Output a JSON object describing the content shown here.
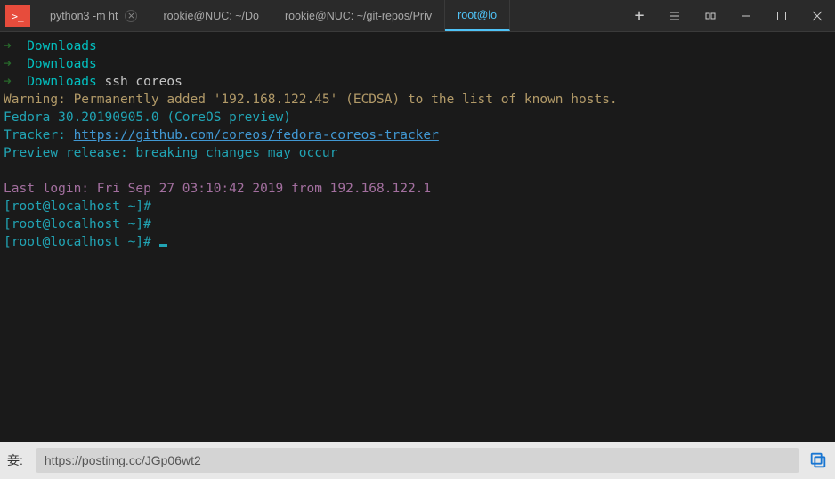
{
  "tabs": [
    {
      "label": "python3 -m ht",
      "closable": true
    },
    {
      "label": "rookie@NUC: ~/Do"
    },
    {
      "label": "rookie@NUC: ~/git-repos/Priv"
    },
    {
      "label": "root@lo",
      "active": true
    }
  ],
  "term": {
    "dir": "Downloads",
    "cmd": "ssh coreos",
    "warn": "Warning: Permanently added '192.168.122.45' (ECDSA) to the list of known hosts.",
    "fedora": "Fedora 30.20190905.0 (CoreOS preview)",
    "tracker_label": "Tracker: ",
    "tracker_url": "https://github.com/coreos/fedora-coreos-tracker",
    "preview": "Preview release: breaking changes may occur",
    "lastlogin": "Last login: Fri Sep 27 03:10:42 2019 from 192.168.122.1",
    "prompt": "[root@localhost ~]#"
  },
  "addrbar": {
    "label": "妾:",
    "url": "https://postimg.cc/JGp06wt2"
  }
}
